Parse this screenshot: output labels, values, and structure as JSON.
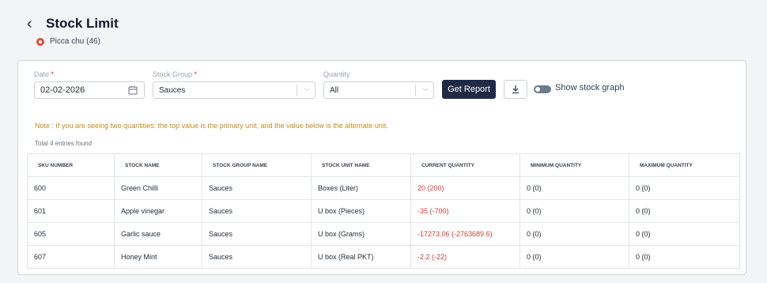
{
  "page": {
    "title": "Stock Limit",
    "store": "Picca chu (46)"
  },
  "filters": {
    "date": {
      "label": "Date",
      "required_mark": "*",
      "value": "02-02-2026"
    },
    "stock_group": {
      "label": "Stock Group",
      "required_mark": "*",
      "value": "Sauces"
    },
    "quantity": {
      "label": "Quantity",
      "value": "All"
    },
    "get_report_label": "Get Report",
    "show_graph_label": "Show stock graph",
    "show_graph_enabled": false
  },
  "note": "Note : If you are seeing two quantities: the top value is the primary unit, and the value below is the alternate unit.",
  "total": "Total 4 entries found",
  "table": {
    "headers": [
      "SKU NUMBER",
      "STOCK NAME",
      "STOCK GROUP NAME",
      "STOCK UNIT NAME",
      "CURRENT QUANTITY",
      "MINIMUM QUANTITY",
      "MAXIMUM QUANTITY"
    ],
    "rows": [
      [
        "600",
        "Green Chilli",
        "Sauces",
        "Boxes (Liter)",
        "20 (200)",
        "0 (0)",
        "0 (0)"
      ],
      [
        "601",
        "Apple vinegar",
        "Sauces",
        "U box (Pieces)",
        "-35 (-700)",
        "0 (0)",
        "0 (0)"
      ],
      [
        "605",
        "Garlic sauce",
        "Sauces",
        "U box (Grams)",
        "-17273.06 (-2763689.6)",
        "0 (0)",
        "0 (0)"
      ],
      [
        "607",
        "Honey Mint",
        "Sauces",
        "U box (Real PKT)",
        "-2.2 (-22)",
        "0 (0)",
        "0 (0)"
      ]
    ]
  },
  "colors": {
    "primary_button": "#1f2a44",
    "quantity_text": "#d93b3b",
    "note_text": "#c58a25",
    "store_dot": "#e04b3b"
  },
  "icons": [
    "chevron-left-icon",
    "store-icon",
    "calendar-icon",
    "chevron-down-icon",
    "download-icon"
  ]
}
